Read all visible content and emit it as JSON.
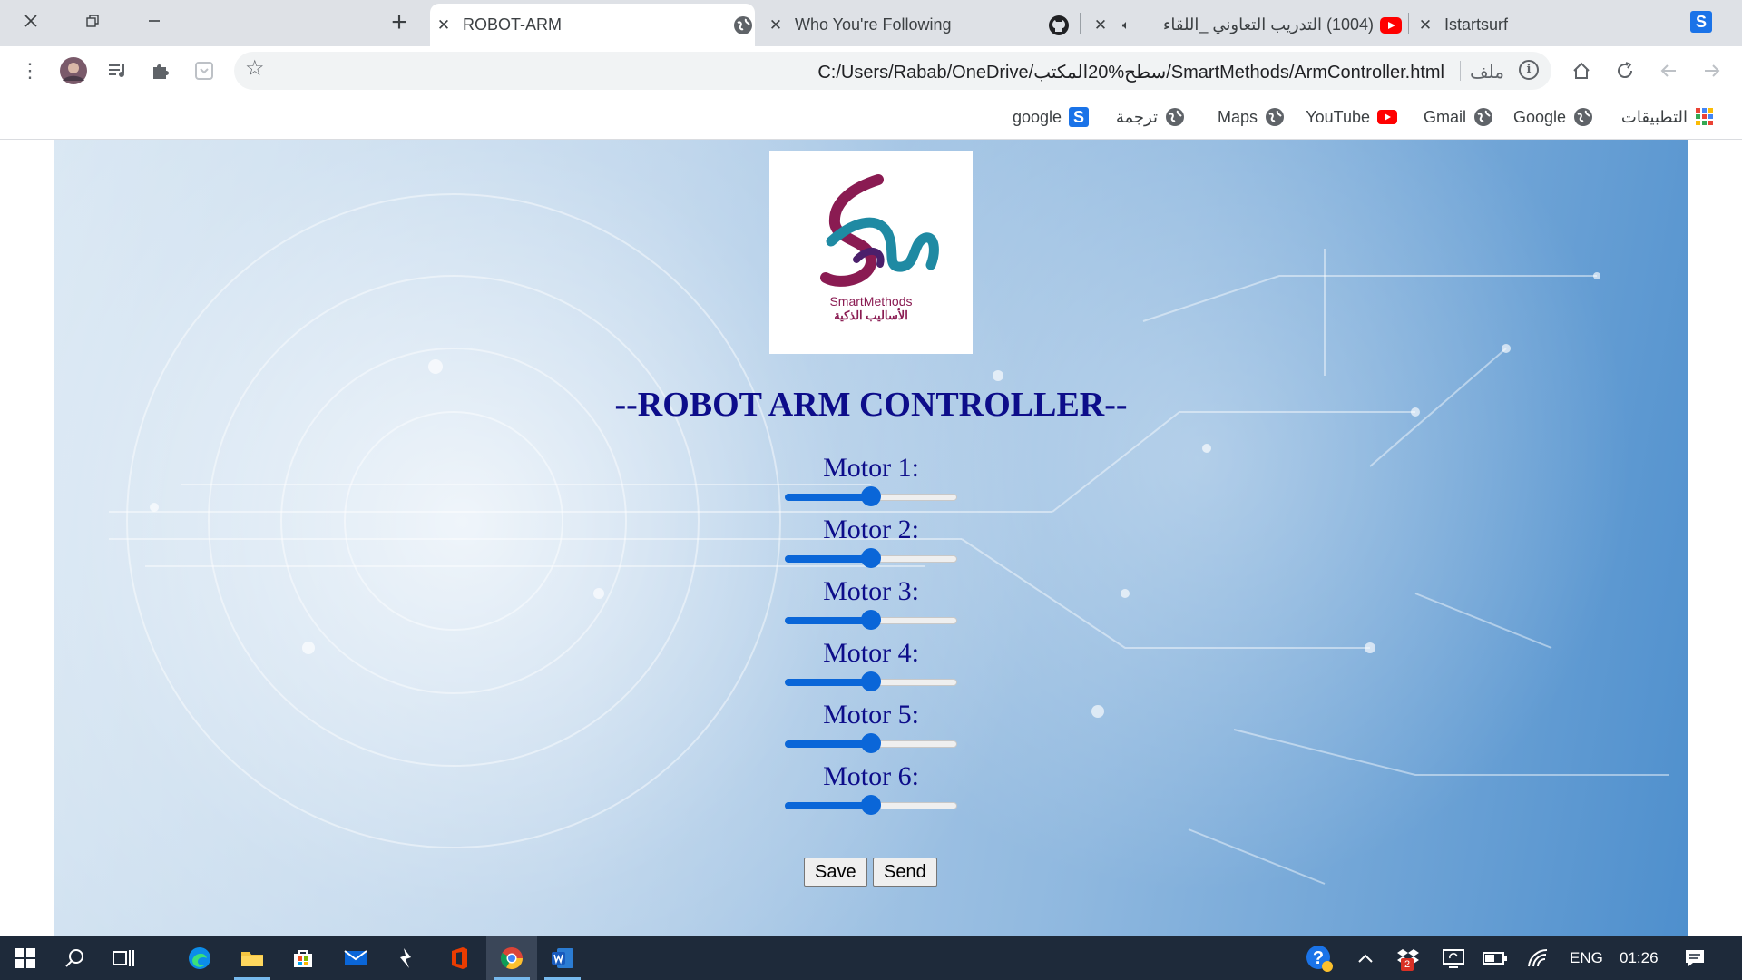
{
  "browser": {
    "tabs": [
      {
        "title": "ROBOT-ARM",
        "active": true,
        "favicon": "globe-icon"
      },
      {
        "title": "Who You're Following",
        "active": false,
        "favicon": "github-icon"
      },
      {
        "title": "(1004) التدريب التعاوني _اللقاء",
        "active": false,
        "favicon": "youtube-icon",
        "audio": true
      },
      {
        "title": "Istartsurf",
        "active": false,
        "favicon": "s-icon"
      }
    ],
    "address": {
      "scheme_label": "ملف",
      "url": "C:/Users/Rabab/OneDrive/سطح%20المكتب/SmartMethods/ArmController.html"
    },
    "bookmarks": [
      {
        "label": "التطبيقات",
        "icon": "apps-grid-icon"
      },
      {
        "label": "Google",
        "icon": "globe-icon"
      },
      {
        "label": "Gmail",
        "icon": "globe-icon"
      },
      {
        "label": "YouTube",
        "icon": "youtube-icon"
      },
      {
        "label": "Maps",
        "icon": "globe-icon"
      },
      {
        "label": "ترجمة",
        "icon": "globe-icon"
      },
      {
        "label": "google",
        "icon": "s-icon"
      }
    ]
  },
  "page": {
    "logo": {
      "text_en": "SmartMethods",
      "text_ar": "الأساليب الذكية"
    },
    "heading": "--ROBOT ARM CONTROLLER--",
    "motors": [
      {
        "label": "Motor 1:",
        "value": 0.5
      },
      {
        "label": "Motor 2:",
        "value": 0.5
      },
      {
        "label": "Motor 3:",
        "value": 0.5
      },
      {
        "label": "Motor 4:",
        "value": 0.5
      },
      {
        "label": "Motor 5:",
        "value": 0.5
      },
      {
        "label": "Motor 6:",
        "value": 0.5
      }
    ],
    "buttons": {
      "save": "Save",
      "send": "Send"
    }
  },
  "taskbar": {
    "language": "ENG",
    "time": "01:26",
    "dropbox_badge": "2",
    "apps": [
      "windows-start-icon",
      "search-icon",
      "task-view-icon",
      "edge-icon",
      "file-explorer-icon",
      "store-icon",
      "mail-icon",
      "app-bolt-icon",
      "office-icon",
      "chrome-icon",
      "word-icon"
    ]
  },
  "colors": {
    "heading": "#0d0d8a",
    "slider": "#0a66d8",
    "taskbar": "#1e2a3a"
  }
}
